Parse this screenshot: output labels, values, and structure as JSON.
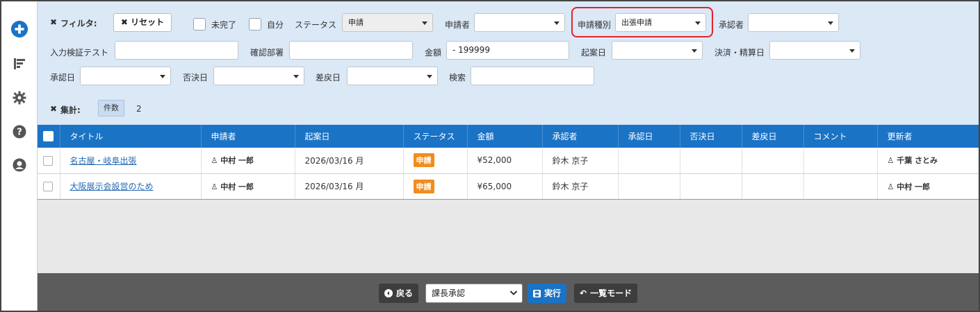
{
  "sidebar": {
    "icons": [
      "add-circle-icon",
      "sort-lines-icon",
      "gear-icon",
      "help-icon",
      "user-icon"
    ]
  },
  "filter": {
    "title": "フィルタ:",
    "reset_label": "リセット",
    "incomplete_label": "未完了",
    "mine_label": "自分",
    "status_label": "ステータス",
    "status_value": "申請",
    "applicant_label": "申請者",
    "applicant_value": "",
    "request_type_label": "申請種別",
    "request_type_value": "出張申請",
    "approver_label": "承認者",
    "approver_value": "",
    "input_test_label": "入力検証テスト",
    "input_test_value": "",
    "dept_label": "確認部署",
    "dept_value": "",
    "amount_label": "金額",
    "amount_value": "- 199999",
    "draft_date_label": "起案日",
    "settle_date_label": "決済・精算日",
    "approve_date_label": "承認日",
    "reject_date_label": "否決日",
    "return_date_label": "差戻日",
    "search_label": "検索",
    "search_value": "",
    "summary_label": "集計:",
    "count_label": "件数",
    "count_value": "2"
  },
  "table": {
    "headers": [
      "タイトル",
      "申請者",
      "起案日",
      "ステータス",
      "金額",
      "承認者",
      "承認日",
      "否決日",
      "差戻日",
      "コメント",
      "更新者"
    ],
    "rows": [
      {
        "title": "名古屋・岐阜出張",
        "applicant": "中村 一郎",
        "date": "2026/03/16 月",
        "status": "申請",
        "amount": "¥52,000",
        "approver": "鈴木 京子",
        "approve_date": "",
        "reject_date": "",
        "return_date": "",
        "comment": "",
        "updater": "千葉 さとみ"
      },
      {
        "title": "大阪展示会設営のため",
        "applicant": "中村 一郎",
        "date": "2026/03/16 月",
        "status": "申請",
        "amount": "¥65,000",
        "approver": "鈴木 京子",
        "approve_date": "",
        "reject_date": "",
        "return_date": "",
        "comment": "",
        "updater": "中村 一郎"
      }
    ]
  },
  "bottom": {
    "back_label": "戻る",
    "action_value": "課長承認",
    "execute_label": "実行",
    "list_mode_label": "一覧モード"
  },
  "colors": {
    "header_blue": "#1a73c5",
    "filter_bg": "#dbe8f6",
    "status_orange": "#f28c1e",
    "highlight_red": "#e0242b"
  }
}
